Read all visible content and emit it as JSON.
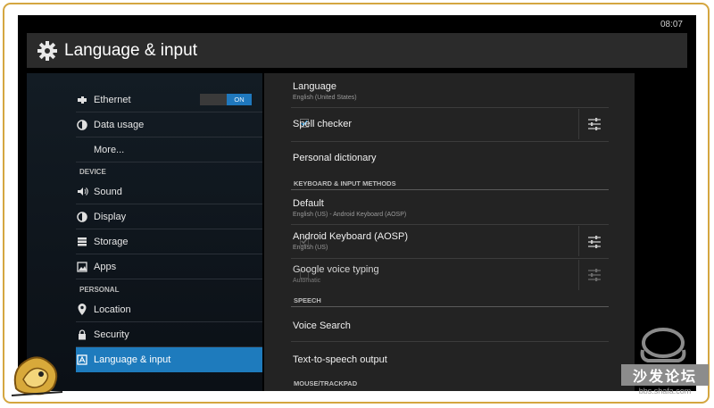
{
  "status_bar": {
    "time": "08:07"
  },
  "header": {
    "title": "Language & input",
    "icon": "gear-icon"
  },
  "left_panel": {
    "items": [
      {
        "label": "Ethernet",
        "icon": "ethernet-icon",
        "toggle": "ON"
      },
      {
        "label": "Data usage",
        "icon": "data-usage-icon"
      },
      {
        "label": "More..."
      }
    ],
    "device_header": "DEVICE",
    "device_items": [
      {
        "label": "Sound",
        "icon": "speaker-icon"
      },
      {
        "label": "Display",
        "icon": "brightness-icon"
      },
      {
        "label": "Storage",
        "icon": "storage-icon"
      },
      {
        "label": "Apps",
        "icon": "apps-icon"
      }
    ],
    "personal_header": "PERSONAL",
    "personal_items": [
      {
        "label": "Location",
        "icon": "location-pin-icon"
      },
      {
        "label": "Security",
        "icon": "lock-icon"
      },
      {
        "label": "Language & input",
        "icon": "language-icon",
        "selected": true
      }
    ]
  },
  "right_panel": {
    "language": {
      "title": "Language",
      "sub": "English (United States)"
    },
    "spell_checker": {
      "title": "Spell checker",
      "checked": true
    },
    "personal_dictionary": {
      "title": "Personal dictionary"
    },
    "keyboard_header": "KEYBOARD & INPUT METHODS",
    "default": {
      "title": "Default",
      "sub": "English (US) - Android Keyboard (AOSP)"
    },
    "android_keyboard": {
      "title": "Android Keyboard (AOSP)",
      "sub": "English (US)",
      "checked": true
    },
    "google_voice": {
      "title": "Google voice typing",
      "sub": "Automatic",
      "checked": false
    },
    "speech_header": "SPEECH",
    "voice_search": {
      "title": "Voice Search"
    },
    "tts": {
      "title": "Text-to-speech output"
    },
    "mouse_header": "MOUSE/TRACKPAD"
  },
  "watermark": {
    "brand": "沙发论坛",
    "url": "bbs.shafa.com"
  },
  "colors": {
    "accent": "#1e7bbd",
    "panel": "#232323",
    "header": "#2b2b2b"
  }
}
